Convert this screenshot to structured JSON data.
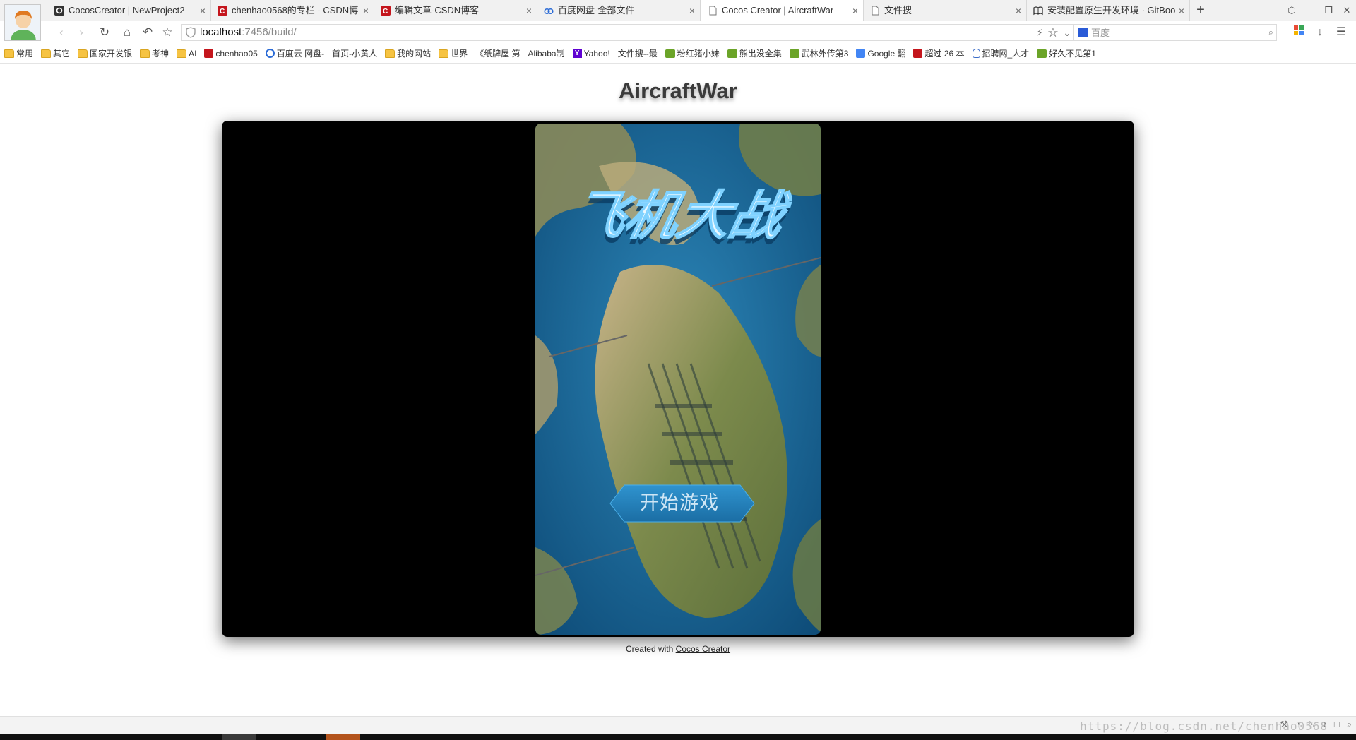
{
  "browser": {
    "tabs": [
      {
        "label": "CocosCreator | NewProject2",
        "favicon": "cocos-icon",
        "active": false
      },
      {
        "label": "chenhao0568的专栏 - CSDN博",
        "favicon": "csdn-icon",
        "active": false
      },
      {
        "label": "编辑文章-CSDN博客",
        "favicon": "csdn-icon",
        "active": false
      },
      {
        "label": "百度网盘-全部文件",
        "favicon": "baidu-cloud-icon",
        "active": false
      },
      {
        "label": "Cocos Creator | AircraftWar",
        "favicon": "page-icon",
        "active": true
      },
      {
        "label": "文件搜",
        "favicon": "page-icon",
        "active": false
      },
      {
        "label": "安装配置原生开发环境 · GitBoo",
        "favicon": "book-icon",
        "active": false
      }
    ],
    "url_host": "localhost",
    "url_path": ":7456/build/",
    "search_placeholder": "百度",
    "bookmarks": [
      {
        "label": "常用",
        "icon": "folder"
      },
      {
        "label": "其它",
        "icon": "folder"
      },
      {
        "label": "国家开发银",
        "icon": "folder"
      },
      {
        "label": "考神",
        "icon": "folder"
      },
      {
        "label": "AI",
        "icon": "folder"
      },
      {
        "label": "chenhao05",
        "icon": "csdn"
      },
      {
        "label": "百度云 网盘-",
        "icon": "baidu"
      },
      {
        "label": "首页-小黄人",
        "icon": "page"
      },
      {
        "label": "我的网站",
        "icon": "folder"
      },
      {
        "label": "世界",
        "icon": "folder"
      },
      {
        "label": "《纸牌屋 第",
        "icon": "page"
      },
      {
        "label": "Alibaba制",
        "icon": "page"
      },
      {
        "label": "Yahoo!",
        "icon": "yahoo"
      },
      {
        "label": "文件搜--最",
        "icon": "page"
      },
      {
        "label": "粉红猪小妹",
        "icon": "iqiyi"
      },
      {
        "label": "熊出没全集",
        "icon": "iqiyi"
      },
      {
        "label": "武林外传第3",
        "icon": "iqiyi"
      },
      {
        "label": "Google 翻",
        "icon": "google"
      },
      {
        "label": "超过 26 本",
        "icon": "csdn"
      },
      {
        "label": "招聘网_人才",
        "icon": "hand"
      },
      {
        "label": "好久不见第1",
        "icon": "iqiyi"
      }
    ]
  },
  "page": {
    "title": "AircraftWar",
    "game_logo": "飞机大战",
    "start_button": "开始游戏",
    "credit_prefix": "Created with ",
    "credit_link": "Cocos Creator"
  },
  "statusbar": {
    "watermark": "https://blog.csdn.net/chenhao0568"
  },
  "colors": {
    "frame": "#000000",
    "sea": "#1f6f9e",
    "button": "#2a86bd",
    "logo": "#e9f7ff"
  }
}
